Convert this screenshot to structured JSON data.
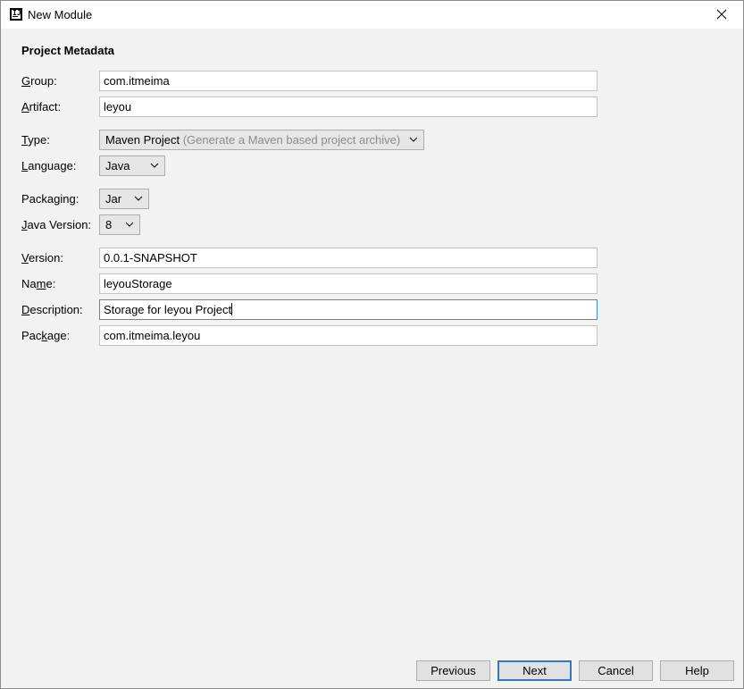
{
  "window": {
    "title": "New Module",
    "app_icon_glyph": "IJ"
  },
  "form": {
    "section_title": "Project Metadata",
    "fields": {
      "group": {
        "label_mnemonic": "G",
        "label_rest": "roup:",
        "value": "com.itmeima"
      },
      "artifact": {
        "label_mnemonic": "A",
        "label_rest": "rtifact:",
        "value": "leyou"
      },
      "type": {
        "label_mnemonic": "T",
        "label_rest": "ype:",
        "value": "Maven Project",
        "hint": "(Generate a Maven based project archive)"
      },
      "language": {
        "label_mnemonic": "L",
        "label_rest": "anguage:",
        "value": "Java"
      },
      "packaging": {
        "label_before": "Packa",
        "label_mnemonic": "g",
        "label_rest": "ing:",
        "value": "Jar"
      },
      "java_version": {
        "label_mnemonic": "J",
        "label_rest": "ava Version:",
        "value": "8"
      },
      "version": {
        "label_mnemonic": "V",
        "label_rest": "ersion:",
        "value": "0.0.1-SNAPSHOT"
      },
      "name": {
        "label_before": "Na",
        "label_mnemonic": "m",
        "label_rest": "e:",
        "value": "leyouStorage"
      },
      "description": {
        "label_mnemonic": "D",
        "label_rest": "escription:",
        "value": "Storage for leyou Project"
      },
      "package": {
        "label_before": "Pac",
        "label_mnemonic": "k",
        "label_rest": "age:",
        "value": "com.itmeima.leyou"
      }
    }
  },
  "buttons": {
    "previous": "Previous",
    "next": "Next",
    "cancel": "Cancel",
    "help": "Help"
  },
  "icons": {
    "close": "close-icon",
    "dropdown": "chevron-down-icon"
  },
  "colors": {
    "dialog_bg": "#f2f2f2",
    "focus_border": "#3c8fd8",
    "default_button_border": "#2f78c6",
    "hint_text": "#8c8c8c"
  }
}
